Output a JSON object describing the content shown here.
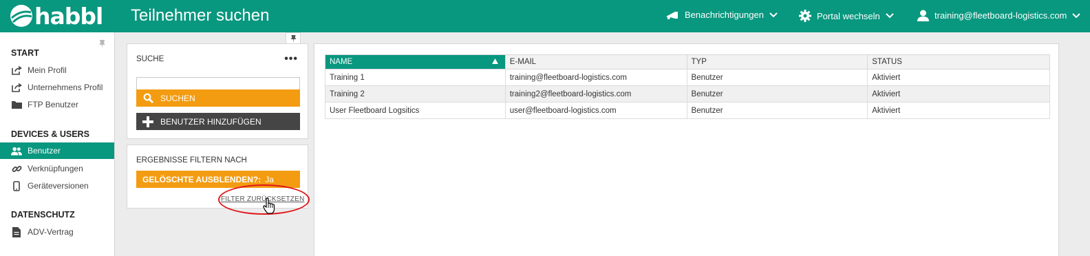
{
  "header": {
    "logo": "habbl",
    "title": "Teilnehmer suchen",
    "notifications_label": "Benachrichtigungen",
    "portal_label": "Portal wechseln",
    "user_label": "training@fleetboard-logistics.com"
  },
  "sidebar": {
    "sections": [
      {
        "title": "START",
        "items": [
          {
            "label": "Mein Profil",
            "icon": "external-link-icon"
          },
          {
            "label": "Unternehmens Profil",
            "icon": "external-link-icon"
          },
          {
            "label": "FTP Benutzer",
            "icon": "folder-icon"
          }
        ]
      },
      {
        "title": "DEVICES & USERS",
        "items": [
          {
            "label": "Benutzer",
            "icon": "users-icon",
            "active": true
          },
          {
            "label": "Verknüpfungen",
            "icon": "link-icon"
          },
          {
            "label": "Geräteversionen",
            "icon": "mobile-icon"
          }
        ]
      },
      {
        "title": "DATENSCHUTZ",
        "items": [
          {
            "label": "ADV-Vertrag",
            "icon": "document-icon"
          }
        ]
      }
    ]
  },
  "search_panel": {
    "label": "SUCHE",
    "input_value": "",
    "search_button": "SUCHEN",
    "add_button": "BENUTZER HINZUFÜGEN"
  },
  "filter_panel": {
    "label": "ERGEBNISSE FILTERN NACH",
    "filter_key": "GELÖSCHTE AUSBLENDEN?:",
    "filter_value": "Ja",
    "reset_link": "FILTER ZURÜCKSETZEN"
  },
  "table": {
    "columns": [
      "NAME",
      "E-MAIL",
      "TYP",
      "STATUS"
    ],
    "sorted_column": "NAME",
    "rows": [
      [
        "Training 1",
        "training@fleetboard-logistics.com",
        "Benutzer",
        "Aktiviert"
      ],
      [
        "Training 2",
        "training2@fleetboard-logistics.com",
        "Benutzer",
        "Aktiviert"
      ],
      [
        "User Fleetboard Logsitics",
        "user@fleetboard-logistics.com",
        "Benutzer",
        "Aktiviert"
      ]
    ]
  },
  "colors": {
    "brand": "#08977f",
    "accent": "#f39c11",
    "dark_button": "#454545",
    "highlight": "#e0161a"
  }
}
